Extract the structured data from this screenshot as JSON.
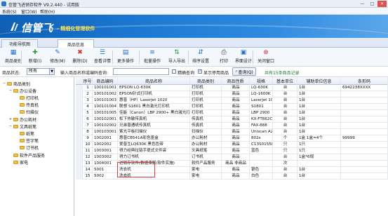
{
  "window": {
    "title": "信管飞进销存软件 V9.2.440 - 试用版",
    "buttons": [
      "—",
      "□",
      "✕"
    ]
  },
  "menu": [
    "系统(S)",
    "窗口(W)",
    "帮助(H)"
  ],
  "banner": {
    "brand": "信管飞",
    "slogan": "- 精细化管理软件"
  },
  "tabs": [
    {
      "label": "功能导航图",
      "active": false
    },
    {
      "label": "商品信息",
      "active": true
    }
  ],
  "toolbar": [
    {
      "label": "商品类别",
      "icon": "category-icon",
      "color": "#1f6fc9"
    },
    {
      "label": "新增(I)",
      "icon": "add-icon",
      "color": "#2b9d3b"
    },
    {
      "label": "修改(M)",
      "icon": "edit-icon",
      "color": "#1f6fc9"
    },
    {
      "label": "删除(D)",
      "icon": "delete-icon",
      "color": "#d9302c"
    },
    {
      "label": "查看详情",
      "icon": "view-icon",
      "color": "#1f6fc9"
    },
    {
      "label": "更多操作",
      "icon": "more-icon",
      "color": "#1f6fc9"
    },
    {
      "label": "批量操作",
      "icon": "batch-icon",
      "color": "#1f6fc9"
    },
    {
      "label": "导入导出",
      "icon": "import-export-icon",
      "color": "#2b9d3b"
    },
    {
      "label": "排序设置",
      "icon": "sort-icon",
      "color": "#1f6fc9"
    },
    {
      "label": "打印",
      "icon": "print-icon",
      "color": "#444444"
    },
    {
      "label": "界面设计",
      "icon": "design-icon",
      "color": "#1f6fc9"
    },
    {
      "label": "关闭窗口",
      "icon": "close-window-icon",
      "color": "#d9302c"
    }
  ],
  "filter": {
    "status_label": "商品状态:",
    "status_value": "所有",
    "search_label": "输入商品名称或编码查询:",
    "search_value": "",
    "fuzzy_label": "精确查询",
    "fuzzy_checked": false,
    "show_disabled_label": "显示停用商品",
    "show_disabled_checked": true,
    "query_button": "查询(Q)",
    "count_text": "共有15条商品记录"
  },
  "tree": [
    {
      "label": "商品类别",
      "level": 0,
      "toggle": "−"
    },
    {
      "label": "办公设备",
      "level": 1,
      "toggle": "−"
    },
    {
      "label": "打印机",
      "level": 2,
      "toggle": ""
    },
    {
      "label": "传真机",
      "level": 2,
      "toggle": ""
    },
    {
      "label": "扫描仪",
      "level": 2,
      "toggle": ""
    },
    {
      "label": "办公耗材",
      "level": 1,
      "toggle": "+"
    },
    {
      "label": "文具纸笔",
      "level": 1,
      "toggle": "−"
    },
    {
      "label": "纸笔",
      "level": 2,
      "toggle": ""
    },
    {
      "label": "签字笔",
      "level": 2,
      "toggle": ""
    },
    {
      "label": "订书机",
      "level": 2,
      "toggle": ""
    },
    {
      "label": "软件产品服务",
      "level": 1,
      "toggle": ""
    },
    {
      "label": "家电",
      "level": 1,
      "toggle": ""
    }
  ],
  "grid": {
    "columns": [
      "序号",
      "商品编码",
      "商品名称",
      "商品类别",
      "商品性质",
      "规格",
      "基本单位",
      "辅助单位信息",
      "条形码"
    ],
    "rows": [
      [
        "1",
        "100101001",
        "EPSON LQ-630K",
        "打印机",
        "商品",
        "LQ-630K",
        "台",
        "1台",
        "6942238XXXX"
      ],
      [
        "2",
        "100101002",
        "EPSON针式打印机",
        "打印机",
        "商品",
        "LQ-1600K",
        "台",
        "1台",
        ""
      ],
      [
        "3",
        "100101003",
        "惠普（HP）LaserJet 1020",
        "打印机",
        "商品",
        "LaserJet 1020",
        "台",
        "1台",
        ""
      ],
      [
        "4",
        "100101004",
        "联想 S1801 黑白激光打印机",
        "打印机",
        "商品",
        "S1801",
        "台",
        "1台",
        ""
      ],
      [
        "5",
        "100101005",
        "佳能（Canon）LBP 2900+ 黑白激光打印机",
        "打印机",
        "商品",
        "LBP 2900",
        "台",
        "1台",
        ""
      ],
      [
        "6",
        "100102001",
        "松下热敏传真机",
        "传真机",
        "商品",
        "KX-FT862CN",
        "台",
        "1台",
        ""
      ],
      [
        "7",
        "100102002",
        "兄弟普通纸传真机",
        "传真机",
        "商品",
        "FAX-888",
        "台",
        "1台",
        ""
      ],
      [
        "8",
        "100103001",
        "紫光平板扫描仪",
        "扫描仪",
        "商品",
        "Uniscan A2000",
        "台",
        "1台",
        ""
      ],
      [
        "9",
        "1002001",
        "惠普CB541A彩色墨盒",
        "办公耗材",
        "商品",
        "802s",
        "个",
        "1盒 1盒=4个",
        "99999"
      ],
      [
        "10",
        "1002002",
        "爱普生LQ630K 黑色色带",
        "办公耗材",
        "商品",
        "C13S015583",
        "只",
        "1只",
        ""
      ],
      [
        "11",
        "1003001",
        "得力经典拉链手提式文件袋",
        "文具纸笔",
        "商品",
        "蓝色",
        "只",
        "1只",
        ""
      ],
      [
        "12",
        "1003002",
        "得力订书机",
        "订书机",
        "商品",
        "",
        "台",
        "1盒*6规",
        ""
      ],
      [
        "13",
        "1004001",
        "进销存软件(数据库版/软件实施)",
        "软件产品服务",
        "商品 非商品",
        "",
        "次",
        "",
        ""
      ],
      [
        "14",
        "5001",
        "洗衣机",
        "家电",
        "商品",
        "银色",
        "台",
        "1台",
        ""
      ],
      [
        "15",
        "5002",
        "洗衣机",
        "家电",
        "商品",
        "白色",
        "台",
        "1台",
        ""
      ]
    ]
  }
}
